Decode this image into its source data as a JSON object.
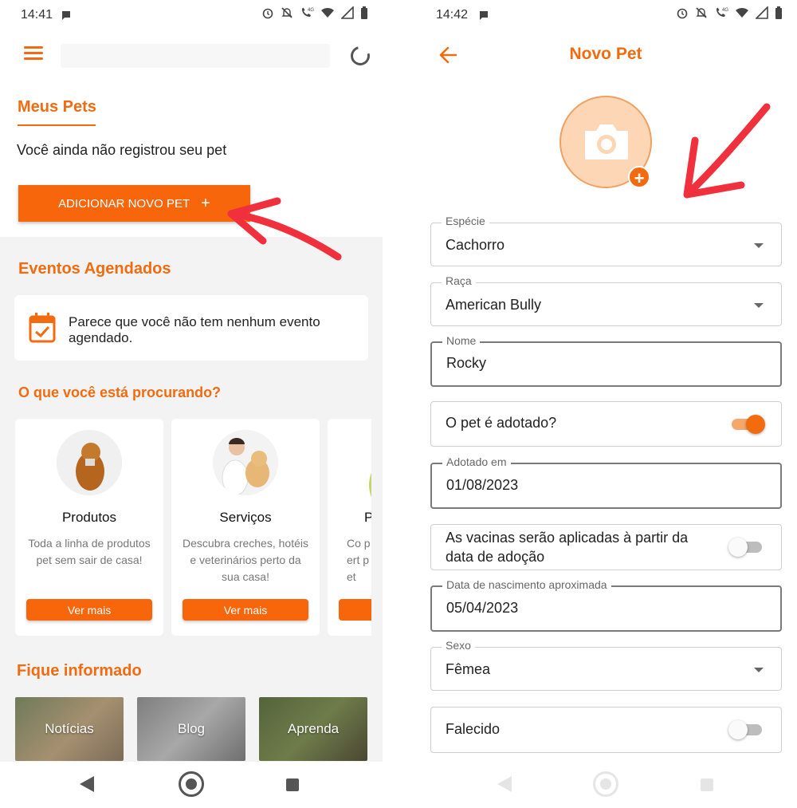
{
  "left": {
    "status": {
      "time": "14:41"
    },
    "my_pets": {
      "title": "Meus Pets",
      "empty_text": "Você ainda não registrou seu pet",
      "add_button_label": "ADICIONAR NOVO PET",
      "add_button_icon": "+"
    },
    "events": {
      "title": "Eventos Agendados",
      "empty_text": "Parece que você não tem nenhum evento agendado."
    },
    "search_section": {
      "title": "O que você está procurando?",
      "cards": [
        {
          "title": "Produtos",
          "description": "Toda a linha de produtos pet sem sair de casa!",
          "button": "Ver mais"
        },
        {
          "title": "Serviços",
          "description": "Descubra creches, hotéis e veterinários perto da sua casa!",
          "button": "Ver mais"
        },
        {
          "title": "P",
          "description": "Co pert pet",
          "button": ""
        }
      ]
    },
    "info_section": {
      "title": "Fique informado",
      "tiles": [
        "Notícias",
        "Blog",
        "Aprenda"
      ]
    }
  },
  "right": {
    "status": {
      "time": "14:42"
    },
    "header": {
      "title": "Novo Pet"
    },
    "photo": {
      "add_icon": "+"
    },
    "fields": {
      "species": {
        "label": "Espécie",
        "value": "Cachorro"
      },
      "breed": {
        "label": "Raça",
        "value": "American Bully"
      },
      "name": {
        "label": "Nome",
        "value": "Rocky"
      },
      "adopted": {
        "label": "O pet é adotado?",
        "on": true
      },
      "adopted_on": {
        "label": "Adotado em",
        "value": "01/08/2023"
      },
      "vaccines": {
        "label": "As vacinas serão aplicadas à partir da data de adoção",
        "on": false
      },
      "birth_date": {
        "label": "Data de nascimento aproximada",
        "value": "05/04/2023"
      },
      "sex": {
        "label": "Sexo",
        "value": "Fêmea"
      },
      "deceased": {
        "label": "Falecido",
        "on": false
      }
    }
  },
  "colors": {
    "accent": "#f26b0f",
    "button": "#f8660c",
    "annotation_arrow": "#f0303c",
    "background_grey": "#f3f3f3"
  }
}
